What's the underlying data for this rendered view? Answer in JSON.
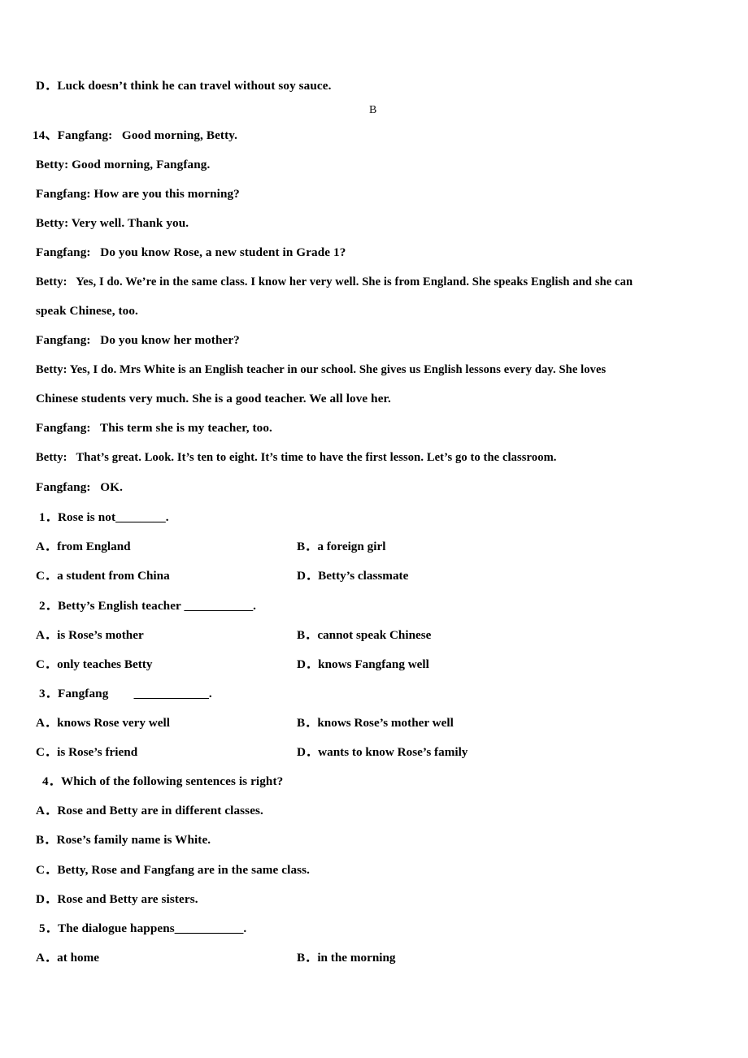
{
  "document": {
    "answer_mark": "B",
    "question_number": "14、"
  },
  "dialogue": {
    "lines": [
      {
        "id": "d0",
        "text": "D．Luck doesn’t think he can travel without soy sauce."
      },
      {
        "id": "d1",
        "text": "14、Fangfang:   Good morning, Betty."
      },
      {
        "id": "d2",
        "text": "Betty: Good morning, Fangfang."
      },
      {
        "id": "d3",
        "text": "Fangfang: How are you this morning?"
      },
      {
        "id": "d4",
        "text": "Betty: Very well. Thank you."
      },
      {
        "id": "d5",
        "text": "Fangfang:   Do you know Rose, a new student in Grade 1?"
      },
      {
        "id": "d6",
        "text": "Betty:   Yes, I do. We’re in the same class. I know her very well. She is from England. She speaks English and she can"
      },
      {
        "id": "d7",
        "text": "speak Chinese, too."
      },
      {
        "id": "d8",
        "text": "Fangfang:   Do you know her mother?"
      },
      {
        "id": "d9",
        "text": "Betty: Yes, I do. Mrs White is an English teacher in our school. She gives us English lessons every day. She loves"
      },
      {
        "id": "d10",
        "text": "Chinese students very much. She is a good teacher. We all love her."
      },
      {
        "id": "d11",
        "text": "Fangfang:   This term she is my teacher, too."
      },
      {
        "id": "d12",
        "text": "Betty:   That’s great. Look. It’s ten to eight. It’s time to have the first lesson. Let’s go to the classroom."
      },
      {
        "id": "d13",
        "text": "Fangfang:   OK."
      }
    ]
  },
  "questions": [
    {
      "id": "q1",
      "stem_prefix": "1．Rose is not",
      "stem_blank": "________",
      "stem_suffix": ".",
      "layout": "two-column",
      "options": [
        {
          "letter": "A．",
          "text": "from England"
        },
        {
          "letter": "B．",
          "text": "a foreign girl"
        },
        {
          "letter": "C．",
          "text": "a student from China"
        },
        {
          "letter": "D．",
          "text": "Betty’s classmate"
        }
      ]
    },
    {
      "id": "q2",
      "stem_prefix": "2．Betty’s English teacher ",
      "stem_blank": "___________",
      "stem_suffix": ".",
      "layout": "two-column",
      "options": [
        {
          "letter": "A．",
          "text": "is Rose’s mother"
        },
        {
          "letter": "B．",
          "text": "cannot speak Chinese"
        },
        {
          "letter": "C．",
          "text": "only teaches Betty"
        },
        {
          "letter": "D．",
          "text": "knows Fangfang well"
        }
      ]
    },
    {
      "id": "q3",
      "stem_prefix": "3．Fangfang        ",
      "stem_blank": "____________",
      "stem_suffix": ".",
      "layout": "two-column",
      "options": [
        {
          "letter": "A．",
          "text": "knows Rose very well"
        },
        {
          "letter": "B．",
          "text": "knows Rose’s mother well"
        },
        {
          "letter": "C．",
          "text": "is Rose’s friend"
        },
        {
          "letter": "D．",
          "text": "wants to know Rose’s family"
        }
      ]
    },
    {
      "id": "q4",
      "stem_prefix": "4．Which of the following sentences is right?",
      "stem_blank": "",
      "stem_suffix": "",
      "layout": "stacked",
      "options": [
        {
          "letter": "A．",
          "text": "Rose and Betty are in different classes."
        },
        {
          "letter": "B．",
          "text": "Rose’s family name is White."
        },
        {
          "letter": "C．",
          "text": "Betty, Rose and Fangfang are in the same class."
        },
        {
          "letter": "D．",
          "text": "Rose and Betty are sisters."
        }
      ]
    },
    {
      "id": "q5",
      "stem_prefix": "5．The dialogue happens",
      "stem_blank": "___________",
      "stem_suffix": ".",
      "layout": "two-column",
      "options": [
        {
          "letter": "A．",
          "text": "at home"
        },
        {
          "letter": "B．",
          "text": "in the morning"
        }
      ]
    }
  ]
}
